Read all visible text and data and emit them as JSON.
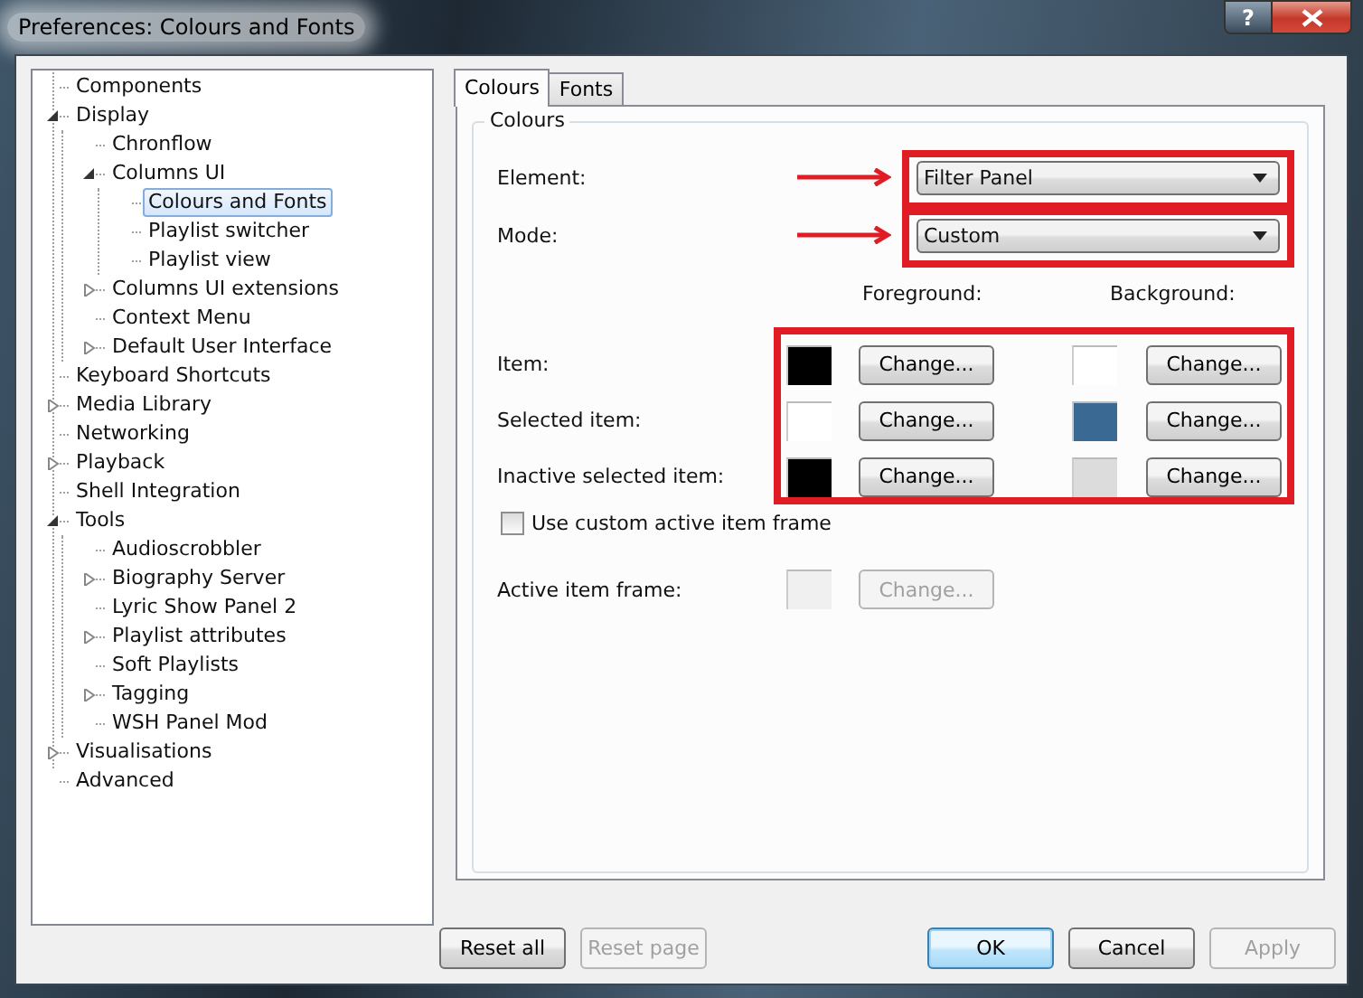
{
  "window": {
    "title": "Preferences: Colours and Fonts",
    "help_button": "?"
  },
  "tree": [
    {
      "label": "Components",
      "selected": false
    },
    {
      "label": "Display",
      "selected": false,
      "expanded": true,
      "children": [
        {
          "label": "Chronflow",
          "selected": false
        },
        {
          "label": "Columns UI",
          "selected": false,
          "expanded": true,
          "children": [
            {
              "label": "Colours and Fonts",
              "selected": true
            },
            {
              "label": "Playlist switcher",
              "selected": false
            },
            {
              "label": "Playlist view",
              "selected": false
            }
          ]
        },
        {
          "label": "Columns UI extensions",
          "selected": false,
          "expanded": false
        },
        {
          "label": "Context Menu",
          "selected": false
        },
        {
          "label": "Default User Interface",
          "selected": false,
          "expanded": false
        }
      ]
    },
    {
      "label": "Keyboard Shortcuts",
      "selected": false
    },
    {
      "label": "Media Library",
      "selected": false,
      "expanded": false
    },
    {
      "label": "Networking",
      "selected": false
    },
    {
      "label": "Playback",
      "selected": false,
      "expanded": false
    },
    {
      "label": "Shell Integration",
      "selected": false
    },
    {
      "label": "Tools",
      "selected": false,
      "expanded": true,
      "children": [
        {
          "label": "Audioscrobbler",
          "selected": false
        },
        {
          "label": "Biography Server",
          "selected": false,
          "expanded": false
        },
        {
          "label": "Lyric Show Panel 2",
          "selected": false
        },
        {
          "label": "Playlist attributes",
          "selected": false,
          "expanded": false
        },
        {
          "label": "Soft Playlists",
          "selected": false
        },
        {
          "label": "Tagging",
          "selected": false,
          "expanded": false
        },
        {
          "label": "WSH Panel Mod",
          "selected": false
        }
      ]
    },
    {
      "label": "Visualisations",
      "selected": false,
      "expanded": false
    },
    {
      "label": "Advanced",
      "selected": false
    }
  ],
  "tabs": [
    {
      "label": "Colours",
      "selected": true
    },
    {
      "label": "Fonts",
      "selected": false
    }
  ],
  "group": {
    "title": "Colours",
    "fields": [
      {
        "label": "Element:",
        "value": "Filter Panel"
      },
      {
        "label": "Mode:",
        "value": "Custom"
      }
    ],
    "headers": [
      "Foreground:",
      "Background:"
    ],
    "rows": [
      {
        "label": "Item:",
        "foreground": {
          "color": "#000000",
          "button": "Change..."
        },
        "background": {
          "color": "#ffffff",
          "button": "Change..."
        }
      },
      {
        "label": "Selected item:",
        "foreground": {
          "color": "#ffffff",
          "button": "Change..."
        },
        "background": {
          "color": "#3a6994",
          "button": "Change..."
        }
      },
      {
        "label": "Inactive selected item:",
        "foreground": {
          "color": "#000000",
          "button": "Change..."
        },
        "background": {
          "color": "#dcdcdc",
          "button": "Change..."
        }
      }
    ],
    "checkbox": {
      "label": "Use custom active item frame",
      "checked": false
    },
    "active_frame": {
      "label": "Active item frame:",
      "color": "#f0f0f0",
      "button": "Change...",
      "disabled": true
    }
  },
  "buttons": [
    {
      "label": "Reset all",
      "disabled": false,
      "default": false
    },
    {
      "label": "Reset page",
      "disabled": true,
      "default": false
    },
    {
      "label": "OK",
      "disabled": false,
      "default": true
    },
    {
      "label": "Cancel",
      "disabled": false,
      "default": false
    },
    {
      "label": "Apply",
      "disabled": true,
      "default": false
    }
  ]
}
